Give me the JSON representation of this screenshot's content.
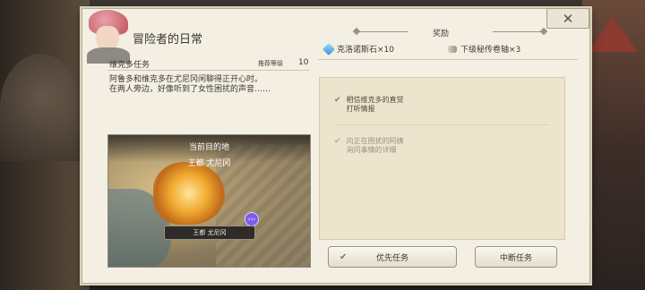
{
  "window": {
    "title": "冒险者的日常",
    "close_symbol": "✕"
  },
  "quest": {
    "name": "维克多任务",
    "recommended_label": "推荐等级",
    "recommended_level": "10",
    "description_line1": "阿鲁多和维克多在尤尼冈闲聊得正开心时。",
    "description_line2": "在两人旁边，好像听到了女性困扰的声音……"
  },
  "map": {
    "header": "当前目的地",
    "region": "王都 尤尼冈",
    "location_tag": "王都 尤尼冈",
    "pin_symbol": "›››"
  },
  "rewards": {
    "title": "奖励",
    "items": [
      {
        "label": "克洛诺斯石×10",
        "icon": "crystal-icon"
      },
      {
        "label": "下级秘传卷轴×3",
        "icon": "scroll-icon"
      }
    ]
  },
  "choices": [
    {
      "line1": "相信维克多的直觉",
      "line2": "打听情报",
      "active": true
    },
    {
      "line1": "向正在困扰的阿姨",
      "line2": "询问事情的详细",
      "active": false
    }
  ],
  "buttons": {
    "priority": "优先任务",
    "abort": "中断任务",
    "check_symbol": "✔"
  },
  "colors": {
    "dialog_bg": "#f3efe3",
    "choice_panel": "#ece4cc",
    "map_tag_bg": "#2e2b28",
    "pin_purple": "#7a5cf0"
  }
}
